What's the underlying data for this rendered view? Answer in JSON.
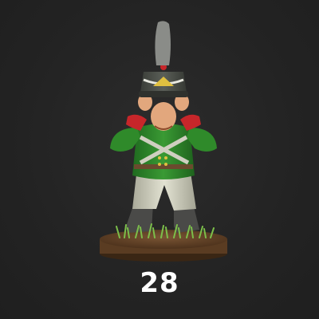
{
  "card": {
    "number": "28"
  },
  "image": {
    "subject": "soldier-miniature-figure",
    "colors": {
      "background": "#242424",
      "coat": "#2f8a2a",
      "cuffs": "#c7262a",
      "trousers": "#d6d6c4",
      "shako": "#4a4e48",
      "base": "#6b4a2e",
      "grass": "#7cbf4a"
    }
  }
}
